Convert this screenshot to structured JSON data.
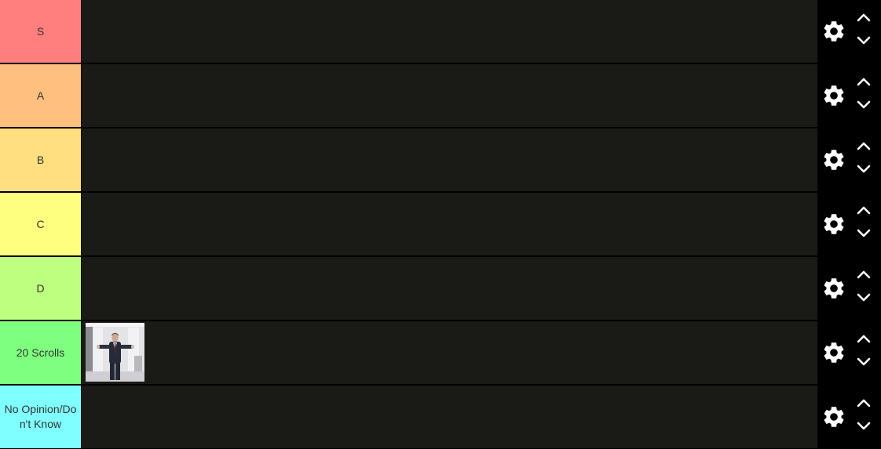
{
  "tiers": [
    {
      "label": "S",
      "color": "#ff7f7f",
      "items": []
    },
    {
      "label": "A",
      "color": "#ffbf7f",
      "items": []
    },
    {
      "label": "B",
      "color": "#ffdf7f",
      "items": []
    },
    {
      "label": "C",
      "color": "#ffff7f",
      "items": []
    },
    {
      "label": "D",
      "color": "#bfff7f",
      "items": []
    },
    {
      "label": "20 Scrolls",
      "color": "#7fff7f",
      "items": [
        {
          "icon": "man-in-suit-arms-outstretched-image"
        }
      ]
    },
    {
      "label": "No Opinion/Don't Know",
      "color": "#7fffff",
      "items": []
    }
  ],
  "controls": {
    "settings_icon": "gear-icon",
    "move_up_icon": "chevron-up-icon",
    "move_down_icon": "chevron-down-icon"
  },
  "colors": {
    "row_background": "#1a1a17",
    "page_background": "#000000",
    "control_icon": "#ffffff",
    "label_text": "#333333"
  }
}
